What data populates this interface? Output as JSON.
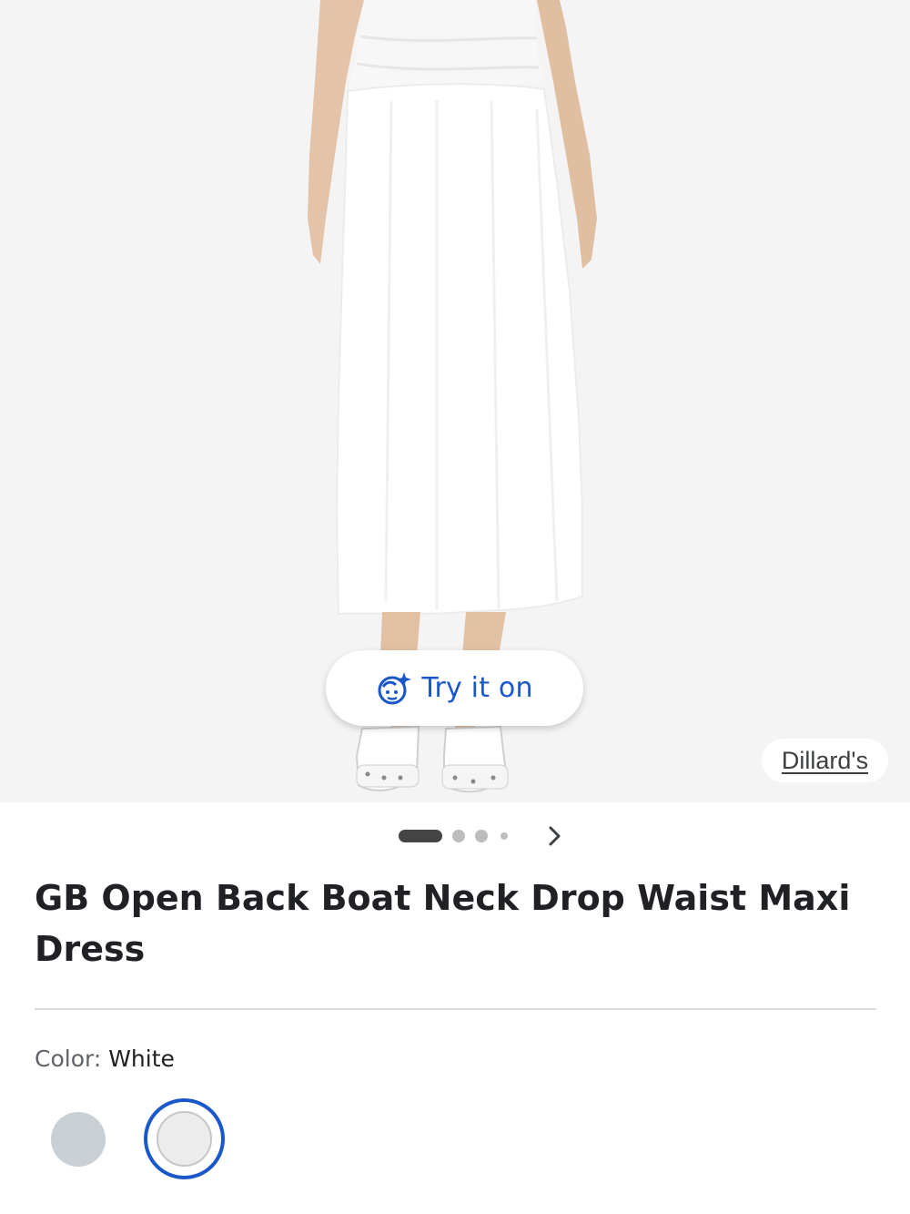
{
  "product": {
    "title": "GB Open Back Boat Neck Drop Waist Maxi Dress",
    "image_alt": "White maxi dress"
  },
  "try_on": {
    "label": "Try it on",
    "icon": "sparkle-face-icon"
  },
  "seller": {
    "name": "Dillard's"
  },
  "gallery": {
    "image_count": 4,
    "current_index": 1,
    "next_icon": "chevron-right-icon"
  },
  "color": {
    "label": "Color:",
    "selected": "White",
    "options": [
      {
        "name": "Gray",
        "hex": "#c8d0d5"
      },
      {
        "name": "White",
        "hex": "#ececec"
      }
    ]
  },
  "colors": {
    "accent": "#1a57c9",
    "background": "#f4f4f4"
  }
}
